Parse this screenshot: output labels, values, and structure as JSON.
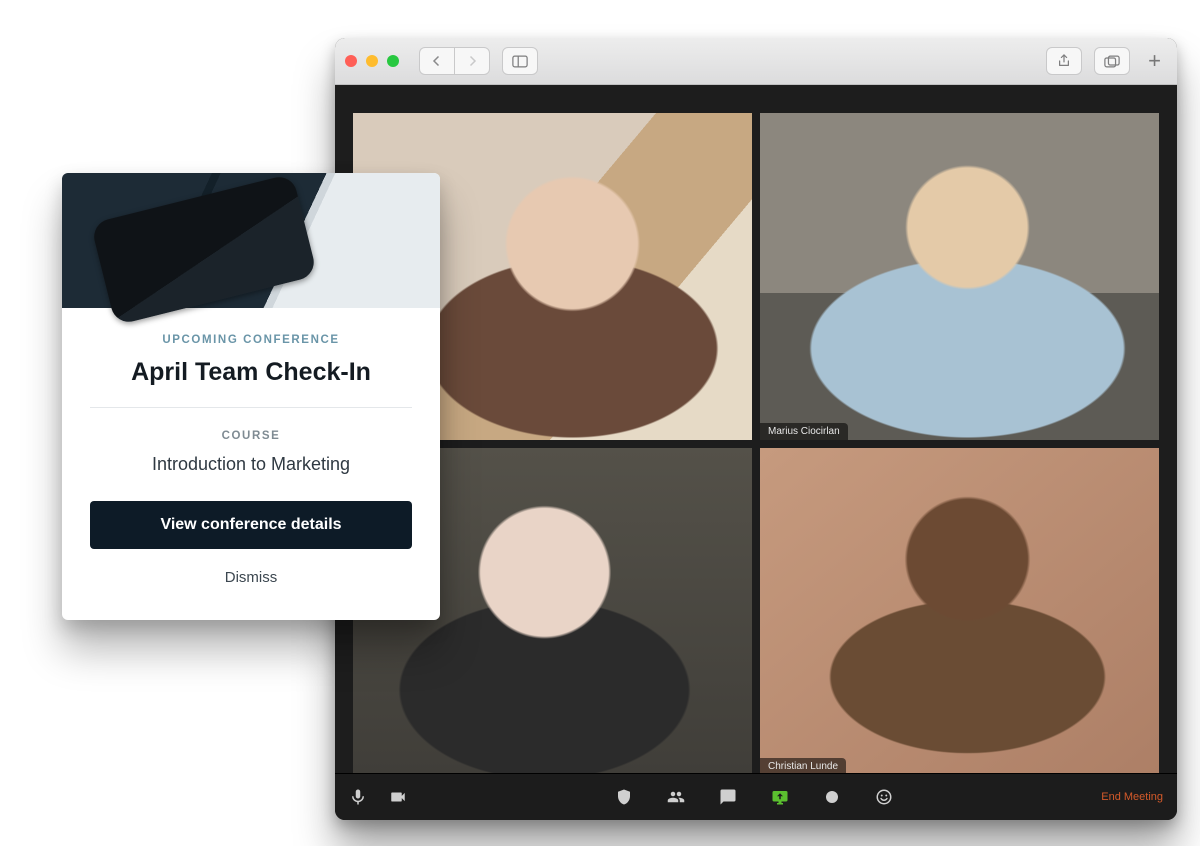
{
  "window": {
    "toolbar": {
      "share_icon": "share-icon",
      "tabs_icon": "tabs-icon",
      "new_tab_icon": "plus-icon"
    }
  },
  "meeting": {
    "participants": [
      {
        "name": "",
        "active": true
      },
      {
        "name": "Marius Ciocirlan",
        "active": false
      },
      {
        "name": "",
        "active": false
      },
      {
        "name": "Christian Lunde",
        "active": false
      }
    ],
    "controls": {
      "end_label": "End Meeting"
    }
  },
  "card": {
    "eyebrow": "UPCOMING CONFERENCE",
    "title": "April Team Check-In",
    "course_label": "COURSE",
    "course_name": "Introduction to Marketing",
    "cta_label": "View conference details",
    "dismiss_label": "Dismiss"
  }
}
